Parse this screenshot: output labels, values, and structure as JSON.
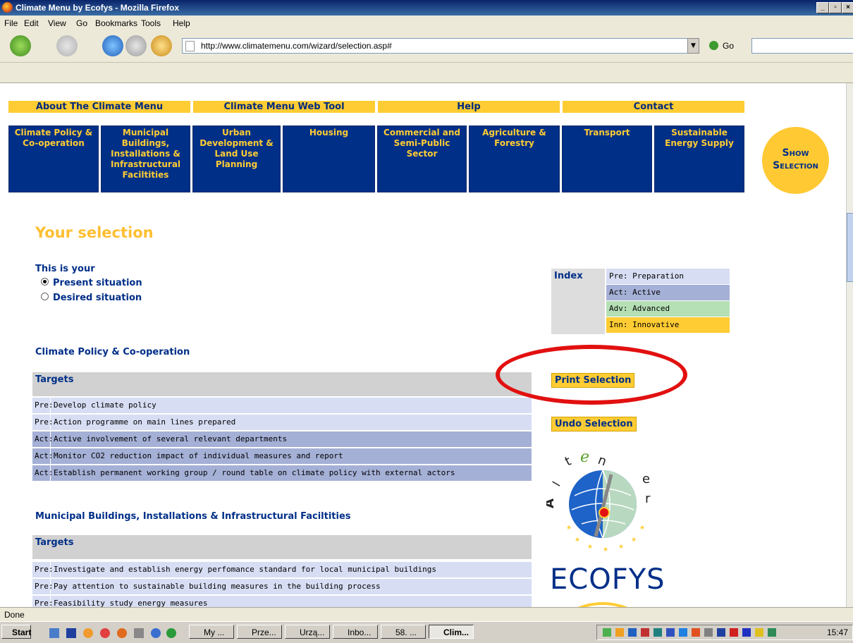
{
  "window": {
    "title": "Climate Menu by Ecofys - Mozilla Firefox"
  },
  "menu": [
    "File",
    "Edit",
    "View",
    "Go",
    "Bookmarks",
    "Tools",
    "Help"
  ],
  "address": {
    "url": "http://www.climatemenu.com/wizard/selection.asp#",
    "go_label": "Go"
  },
  "topnav": [
    "About The Climate Menu",
    "Climate Menu Web Tool",
    "Help",
    "Contact"
  ],
  "categories": [
    "Climate Policy & Co-operation",
    "Municipal Buildings, Installations & Infrastructural Faciltities",
    "Urban Development & Land Use Planning",
    "Housing",
    "Commercial and Semi-Public Sector",
    "Agriculture & Forestry",
    "Transport",
    "Sustainable Energy Supply"
  ],
  "show_selection": {
    "line1": "Show",
    "line2": "Selection"
  },
  "page": {
    "title": "Your selection",
    "situation_label": "This is your",
    "options": [
      "Present situation",
      "Desired situation"
    ],
    "selected_option": "Present situation"
  },
  "index": {
    "label": "Index",
    "rows": [
      {
        "text": "Pre: Preparation",
        "color": "#d7ddf3"
      },
      {
        "text": "Act: Active",
        "color": "#a5b0d6"
      },
      {
        "text": "Adv: Advanced",
        "color": "#b5dfb5"
      },
      {
        "text": "Inn: Innovative",
        "color": "#ffcc33"
      }
    ]
  },
  "buttons": {
    "print": "Print Selection",
    "undo": "Undo Selection"
  },
  "sections": [
    {
      "title": "Climate Policy & Co-operation",
      "targets_label": "Targets",
      "rows": [
        {
          "code": "Pre:",
          "text": "Develop climate policy"
        },
        {
          "code": "Pre:",
          "text": "Action programme on main lines prepared"
        },
        {
          "code": "Act:",
          "text": "Active involvement of several relevant departments"
        },
        {
          "code": "Act:",
          "text": "Monitor CO2 reduction impact of individual measures and report"
        },
        {
          "code": "Act:",
          "text": "Establish permanent working group / round table on climate policy with external actors"
        }
      ]
    },
    {
      "title": "Municipal Buildings, Installations & Infrastructural Faciltities",
      "targets_label": "Targets",
      "rows": [
        {
          "code": "Pre:",
          "text": "Investigate and establish energy perfomance standard for local municipal buildings"
        },
        {
          "code": "Pre:",
          "text": "Pay attention to sustainable building measures in the building process"
        },
        {
          "code": "Pre:",
          "text": "Feasibility study energy measures"
        }
      ]
    }
  ],
  "logos": {
    "altener": "altener",
    "ecofys": "ECOFYS"
  },
  "status": "Done",
  "taskbar": {
    "start": "Start",
    "tasks": [
      "My ...",
      "Prze...",
      "Urzą...",
      "Inbo...",
      "58. ...",
      "Clim..."
    ],
    "active_task": "Clim...",
    "clock": "15:47"
  },
  "colors": {
    "navy": "#002f88",
    "yellow": "#ffcc33",
    "highlight_red": "#e21010"
  }
}
